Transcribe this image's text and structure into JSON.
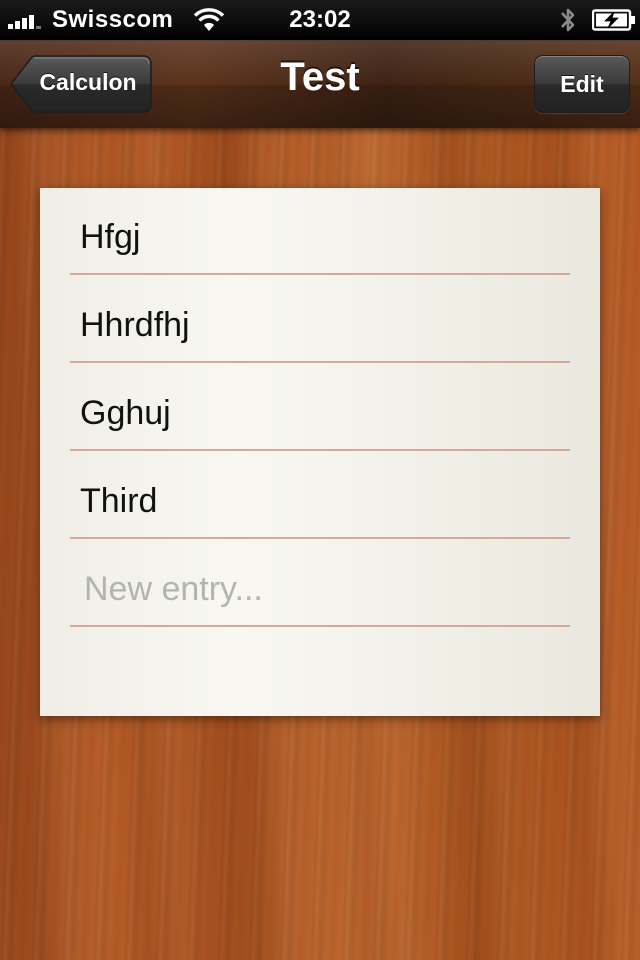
{
  "status_bar": {
    "carrier": "Swisscom",
    "time": "23:02",
    "signal_icon": "signal-bars-icon",
    "wifi_icon": "wifi-icon",
    "bluetooth_icon": "bluetooth-icon",
    "battery_icon": "battery-charging-icon"
  },
  "nav": {
    "back_label": "Calculon",
    "title": "Test",
    "edit_label": "Edit"
  },
  "list": {
    "items": [
      {
        "text": "Hfgj"
      },
      {
        "text": "Hhrdfhj"
      },
      {
        "text": "Gghuj"
      },
      {
        "text": "Third"
      }
    ],
    "new_entry": {
      "value": "",
      "placeholder": "New entry..."
    }
  },
  "colors": {
    "line": "#d4a99a",
    "wood": "#b05a27",
    "paper": "#f6f5ef",
    "placeholder": "#b3b3b0"
  }
}
